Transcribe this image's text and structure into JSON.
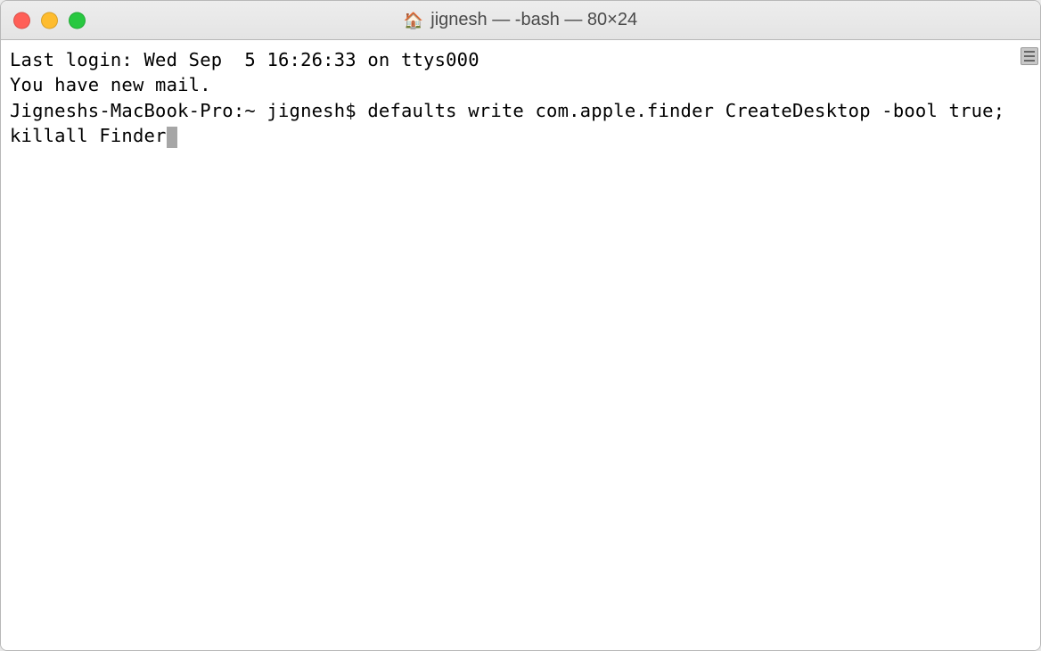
{
  "titlebar": {
    "icon": "home-icon",
    "title": "jignesh — -bash — 80×24"
  },
  "terminal": {
    "lines": [
      "Last login: Wed Sep  5 16:26:33 on ttys000",
      "You have new mail."
    ],
    "prompt": "Jigneshs-MacBook-Pro:~ jignesh$ ",
    "command": "defaults write com.apple.finder CreateDesktop -bool true; killall Finder"
  },
  "colors": {
    "close": "#ff5f57",
    "minimize": "#febc2e",
    "zoom": "#28c840"
  }
}
